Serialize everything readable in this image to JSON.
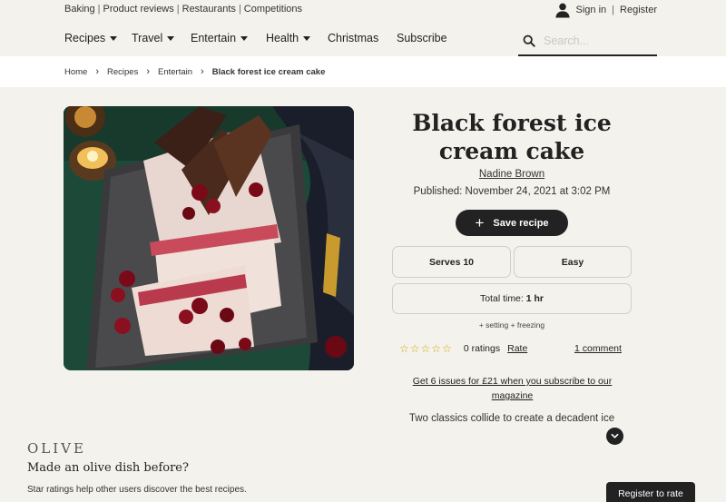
{
  "top_links": [
    "Baking",
    "Product reviews",
    "Restaurants",
    "Competitions"
  ],
  "account": {
    "sign_in": "Sign in",
    "register": "Register",
    "icon": "user-icon"
  },
  "nav": {
    "items": [
      {
        "label": "Recipes",
        "dropdown": true
      },
      {
        "label": "Travel",
        "dropdown": true
      },
      {
        "label": "Entertain",
        "dropdown": true
      },
      {
        "label": "Health",
        "dropdown": true
      },
      {
        "label": "Christmas",
        "dropdown": false
      },
      {
        "label": "Subscribe",
        "dropdown": false
      }
    ],
    "search_placeholder": "Search..."
  },
  "breadcrumb": [
    "Home",
    "Recipes",
    "Entertain",
    "Black forest ice cream cake"
  ],
  "recipe": {
    "title": "Black forest ice cream cake",
    "author": "Nadine Brown",
    "published": "Published: November 24, 2021 at 3:02 PM",
    "save_label": "Save recipe",
    "serves": "Serves 10",
    "difficulty": "Easy",
    "total_time_label": "Total time:",
    "total_time_value": "1 hr",
    "time_note": "+ setting + freezing",
    "stars": 0,
    "ratings_text": "0 ratings",
    "rate_label": "Rate",
    "comments_label": "1 comment",
    "subscribe_offer": "Get 6 issues for £21 when you subscribe to our magazine",
    "description": "Two classics collide to create a decadent ice"
  },
  "promo": {
    "logo": "OLIVE",
    "heading": "Made an olive dish before?",
    "text": "Star ratings help other users discover the best recipes.",
    "button": "Register to rate"
  },
  "colors": {
    "accent": "#222222",
    "star": "#d9a400",
    "page_bg": "#f4f2ec",
    "crumb_bg": "#ffffff"
  }
}
